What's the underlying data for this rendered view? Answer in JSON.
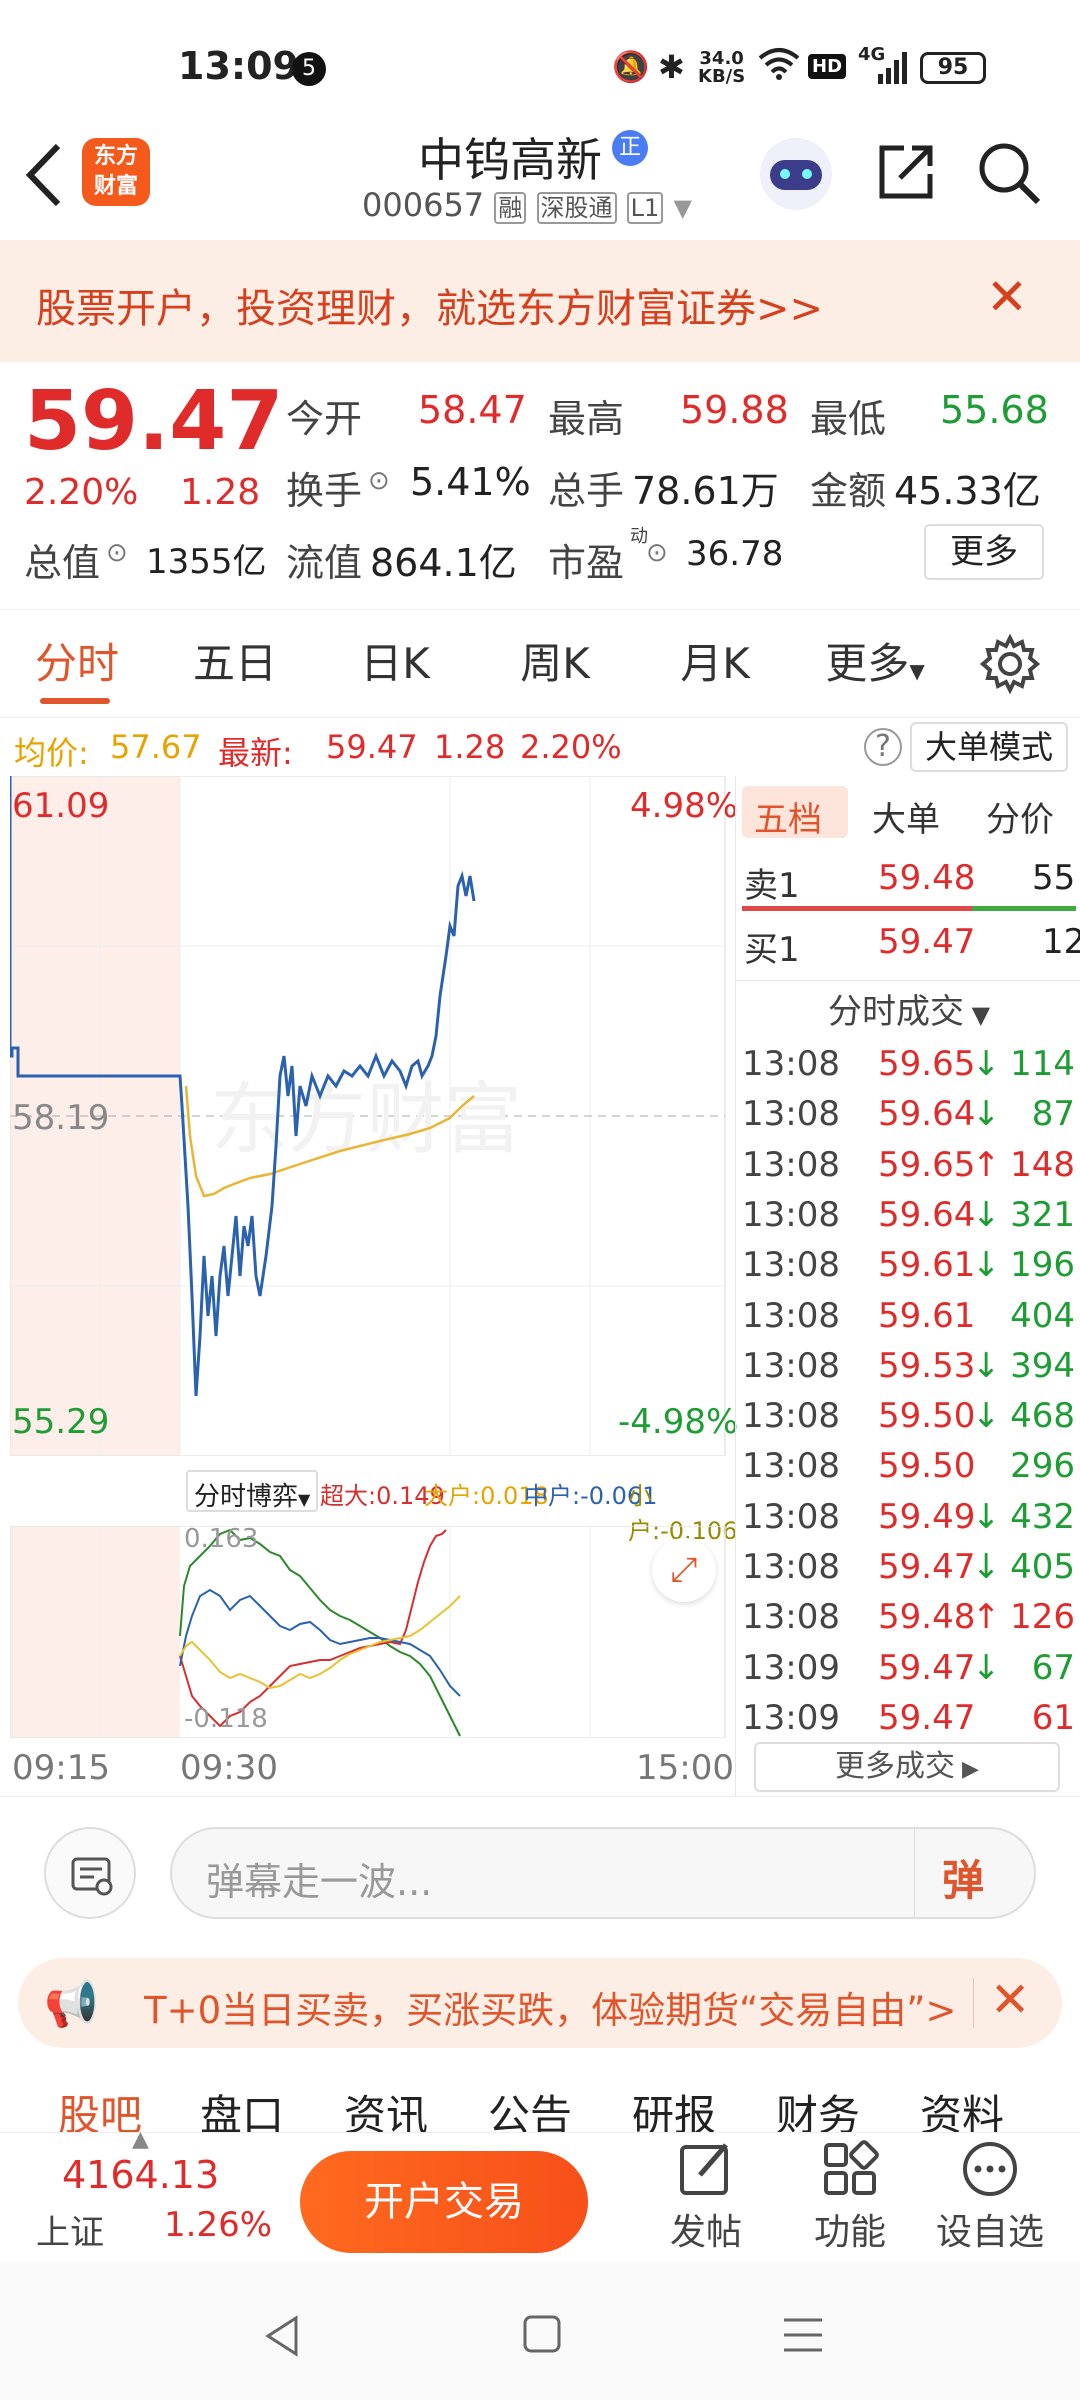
{
  "status_bar": {
    "time": "13:09",
    "notif_count": "5",
    "net_speed_top": "34.0",
    "net_speed_bottom": "KB/S",
    "hd": "HD",
    "net": "4G",
    "battery": "95"
  },
  "header": {
    "logo_line1": "东方",
    "logo_line2": "财富",
    "stock_name": "中钨高新",
    "badge": "正",
    "code": "000657",
    "tags": [
      "融",
      "深股通",
      "L1"
    ]
  },
  "promo": {
    "text": "股票开户，投资理财，就选东方财富证券>>"
  },
  "quote": {
    "price": "59.47",
    "change_pct": "2.20%",
    "change": "1.28",
    "open_label": "今开",
    "open": "58.47",
    "high_label": "最高",
    "high": "59.88",
    "low_label": "最低",
    "low": "55.68",
    "turnover_label": "换手",
    "turnover": "5.41%",
    "volume_label": "总手",
    "volume": "78.61万",
    "amount_label": "金额",
    "amount": "45.33亿",
    "mktcap_label": "总值",
    "mktcap": "1355亿",
    "float_label": "流值",
    "float_cap": "864.1亿",
    "pe_label": "市盈",
    "pe_sup": "动",
    "pe": "36.78",
    "more_button": "更多"
  },
  "k_tabs": [
    "分时",
    "五日",
    "日K",
    "周K",
    "月K",
    "更多"
  ],
  "chart_info": {
    "avg_label": "均价:",
    "avg": "57.67",
    "latest_label": "最新:",
    "latest": "59.47",
    "change": "1.28",
    "change_pct": "2.20%",
    "big_order_button": "大单模式"
  },
  "chart_data": {
    "type": "line",
    "price_axis": {
      "top": "61.09",
      "mid": "58.19",
      "bottom": "55.29",
      "pct_top": "4.98%",
      "pct_bottom": "-4.98%"
    },
    "x_ticks": [
      "09:15",
      "09:30",
      "15:00"
    ],
    "watermark": "东方财富",
    "indicator": {
      "selector": "分时博弈",
      "super": "超大:0.149",
      "large": "大户:0.018",
      "mid": "中户:-0.061",
      "small": "小户:-0.106",
      "top_val": "0.163",
      "bottom_val": "-0.118"
    },
    "colors": {
      "price": "#2a62b0",
      "avg": "#e8b634",
      "super": "#d62f2f",
      "large": "#2a8a2a",
      "mid": "#2a62b0",
      "small": "#e8c233"
    }
  },
  "orderbook": {
    "tabs": [
      "五档",
      "大单",
      "分价"
    ],
    "sell1": {
      "label": "卖1",
      "price": "59.48",
      "vol": "55"
    },
    "buy1": {
      "label": "买1",
      "price": "59.47",
      "vol": "12"
    },
    "trades_title": "分时成交",
    "trades": [
      {
        "time": "13:08",
        "price": "59.65",
        "dir": "↓",
        "vol": "114",
        "vc": "green"
      },
      {
        "time": "13:08",
        "price": "59.64",
        "dir": "↓",
        "vol": "87",
        "vc": "green"
      },
      {
        "time": "13:08",
        "price": "59.65",
        "dir": "↑",
        "vol": "148",
        "vc": "red"
      },
      {
        "time": "13:08",
        "price": "59.64",
        "dir": "↓",
        "vol": "321",
        "vc": "green"
      },
      {
        "time": "13:08",
        "price": "59.61",
        "dir": "↓",
        "vol": "196",
        "vc": "green"
      },
      {
        "time": "13:08",
        "price": "59.61",
        "dir": "",
        "vol": "404",
        "vc": "green"
      },
      {
        "time": "13:08",
        "price": "59.53",
        "dir": "↓",
        "vol": "394",
        "vc": "green"
      },
      {
        "time": "13:08",
        "price": "59.50",
        "dir": "↓",
        "vol": "468",
        "vc": "green"
      },
      {
        "time": "13:08",
        "price": "59.50",
        "dir": "",
        "vol": "296",
        "vc": "green"
      },
      {
        "time": "13:08",
        "price": "59.49",
        "dir": "↓",
        "vol": "432",
        "vc": "green"
      },
      {
        "time": "13:08",
        "price": "59.47",
        "dir": "↓",
        "vol": "405",
        "vc": "green"
      },
      {
        "time": "13:08",
        "price": "59.48",
        "dir": "↑",
        "vol": "126",
        "vc": "red"
      },
      {
        "time": "13:09",
        "price": "59.47",
        "dir": "↓",
        "vol": "67",
        "vc": "green"
      },
      {
        "time": "13:09",
        "price": "59.47",
        "dir": "",
        "vol": "61",
        "vc": "red"
      }
    ],
    "more_trades": "更多成交"
  },
  "danmu": {
    "placeholder": "弹幕走一波...",
    "send": "弹"
  },
  "ad": {
    "text": "T+0当日买卖，买涨买跌，体验期货“交易自由”>"
  },
  "sub_tabs": [
    "股吧",
    "盘口",
    "资讯",
    "公告",
    "研报",
    "财务",
    "资料"
  ],
  "bottom": {
    "index_value": "4164.13",
    "index_name": "上证",
    "index_pct": "1.26%",
    "trade_button": "开户交易",
    "post": "发帖",
    "func": "功能",
    "watch": "设自选"
  }
}
